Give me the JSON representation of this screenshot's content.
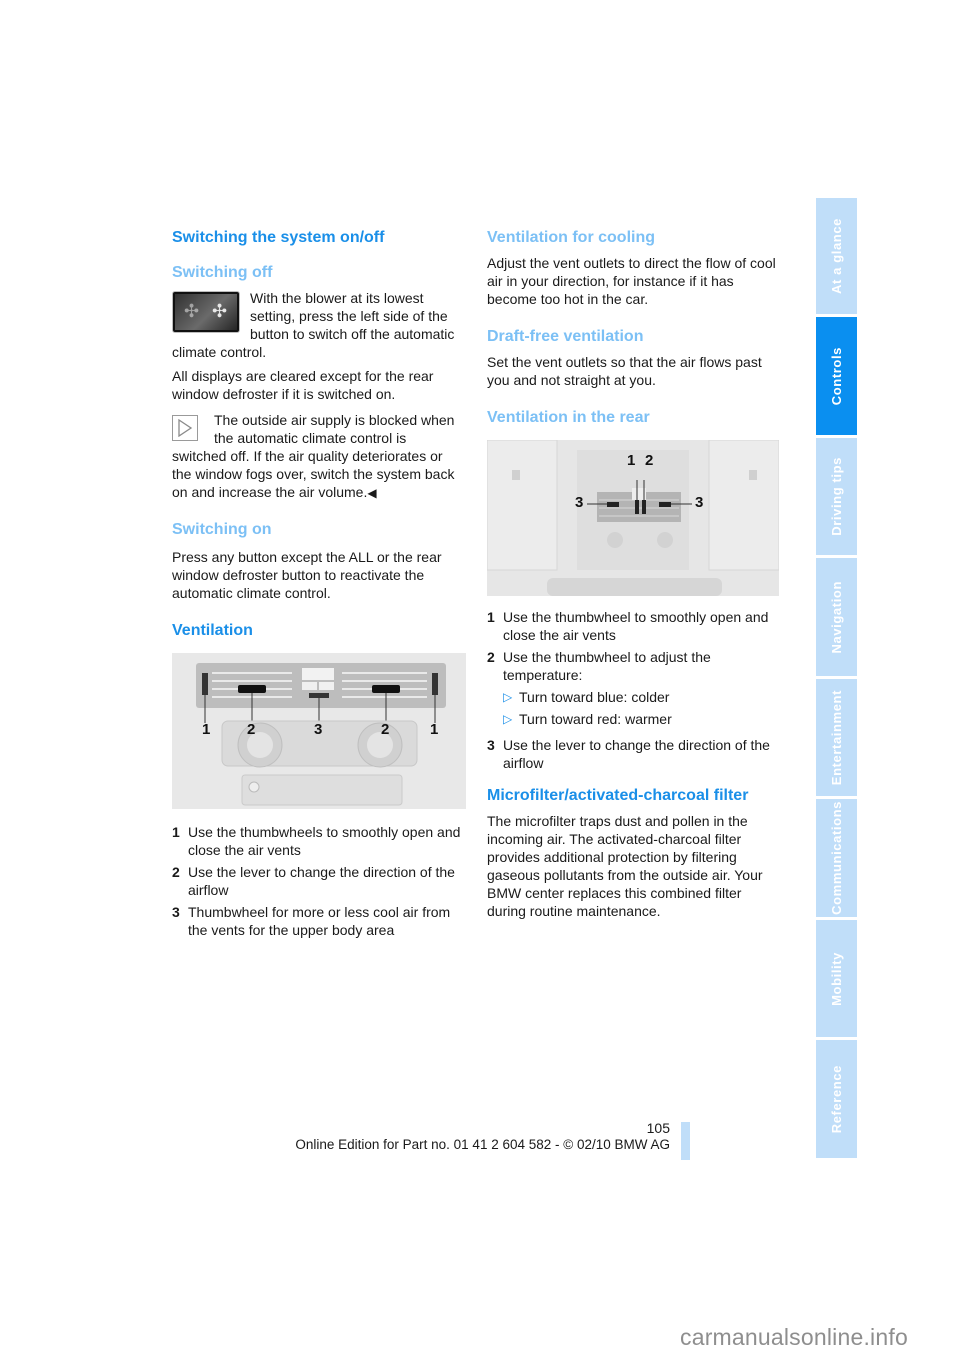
{
  "left_column": {
    "section_title": "Switching the system on/off",
    "switching_off": {
      "heading": "Switching off",
      "para1": "With the blower at its lowest setting, press the left side of the button to switch off the automatic climate control.",
      "para2": "All displays are cleared except for the rear window defroster if it is switched on.",
      "note": "The outside air supply is blocked when the automatic climate control is switched off. If the air quality deteriorates or the window fogs over, switch the system back on and increase the air volume.",
      "end_mark": "◀"
    },
    "switching_on": {
      "heading": "Switching on",
      "para": "Press any button except the ALL or the rear window defroster button to reactivate the automatic climate control."
    },
    "ventilation": {
      "heading": "Ventilation",
      "figure_labels": [
        "1",
        "2",
        "3",
        "2",
        "1"
      ],
      "items": [
        {
          "num": "1",
          "text": "Use the thumbwheels to smoothly open and close the air vents"
        },
        {
          "num": "2",
          "text": "Use the lever to change the direction of the airflow"
        },
        {
          "num": "3",
          "text": "Thumbwheel for more or less cool air from the vents for the upper body area"
        }
      ]
    }
  },
  "right_column": {
    "cooling": {
      "heading": "Ventilation for cooling",
      "para": "Adjust the vent outlets to direct the flow of cool air in your direction, for instance if it has become too hot in the car."
    },
    "draft_free": {
      "heading": "Draft-free ventilation",
      "para": "Set the vent outlets so that the air flows past you and not straight at you."
    },
    "rear": {
      "heading": "Ventilation in the rear",
      "figure_labels": [
        "1",
        "2",
        "3",
        "3"
      ],
      "items": [
        {
          "num": "1",
          "text": "Use the thumbwheel to smoothly open and close the air vents"
        },
        {
          "num": "2",
          "text": "Use the thumbwheel to adjust the temperature:",
          "bullets": [
            "Turn toward blue: colder",
            "Turn toward red: warmer"
          ]
        },
        {
          "num": "3",
          "text": "Use the lever to change the direction of the airflow"
        }
      ]
    },
    "filter": {
      "heading": "Microfilter/activated-charcoal filter",
      "para": "The microfilter traps dust and pollen in the incoming air. The activated-charcoal filter provides additional protection by filtering gaseous pollutants from the outside air. Your BMW center replaces this combined filter during routine maintenance."
    }
  },
  "sidebar": {
    "tabs": [
      {
        "label": "At a glance",
        "active": false
      },
      {
        "label": "Controls",
        "active": true
      },
      {
        "label": "Driving tips",
        "active": false
      },
      {
        "label": "Navigation",
        "active": false
      },
      {
        "label": "Entertainment",
        "active": false
      },
      {
        "label": "Communications",
        "active": false
      },
      {
        "label": "Mobility",
        "active": false
      },
      {
        "label": "Reference",
        "active": false
      }
    ],
    "colors": {
      "active": "#0a8ff0",
      "inactive": "#c0def9"
    }
  },
  "footer": {
    "page_number": "105",
    "edition": "Online Edition for Part no. 01 41 2 604 582 - © 02/10 BMW AG"
  },
  "watermark": "carmanualsonline.info",
  "colors": {
    "heading_primary": "#1a8fe8",
    "heading_secondary": "#7cc0f5",
    "bullet": "#1a8fe8"
  }
}
